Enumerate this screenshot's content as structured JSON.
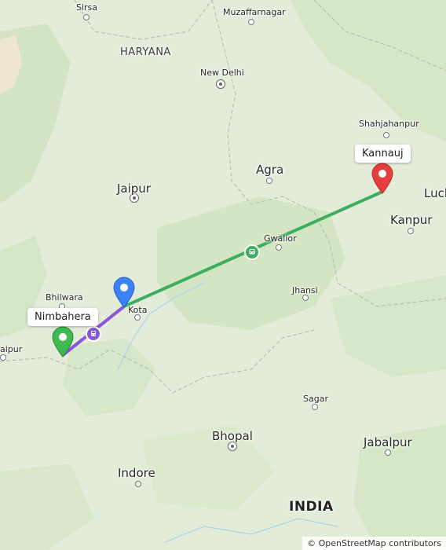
{
  "map": {
    "colors": {
      "land": "#e3ecd9",
      "forest": "#cfe2bf",
      "route_train": "#3dae5f",
      "route_bus": "#8a55d6",
      "pin_origin": "#3fb950",
      "pin_stop": "#3b82f6",
      "pin_destination": "#e53e3e"
    },
    "cities": [
      {
        "id": "sirsa",
        "name": "Sirsa"
      },
      {
        "id": "muzaffarnagar",
        "name": "Muzaffarnagar"
      },
      {
        "id": "haryana",
        "name": "HARYANA"
      },
      {
        "id": "new-delhi",
        "name": "New Delhi"
      },
      {
        "id": "shahjahanpur",
        "name": "Shahjahanpur"
      },
      {
        "id": "agra",
        "name": "Agra"
      },
      {
        "id": "jaipur",
        "name": "Jaipur"
      },
      {
        "id": "luck",
        "name": "Luck"
      },
      {
        "id": "kanpur",
        "name": "Kanpur"
      },
      {
        "id": "gwalior",
        "name": "Gwalior"
      },
      {
        "id": "bhilwara",
        "name": "Bhilwara"
      },
      {
        "id": "kota",
        "name": "Kota"
      },
      {
        "id": "jhansi",
        "name": "Jhansi"
      },
      {
        "id": "aipur",
        "name": "aipur"
      },
      {
        "id": "sagar",
        "name": "Sagar"
      },
      {
        "id": "bhopal",
        "name": "Bhopal"
      },
      {
        "id": "jabalpur",
        "name": "Jabalpur"
      },
      {
        "id": "indore",
        "name": "Indore"
      },
      {
        "id": "india",
        "name": "INDIA"
      }
    ],
    "markers": {
      "origin": {
        "label": "Nimbahera",
        "icon": "map-pin-icon"
      },
      "stop": {
        "icon": "map-pin-icon"
      },
      "destination": {
        "label": "Kannauj",
        "icon": "map-pin-icon"
      }
    },
    "route_icons": {
      "bus": "bus-icon",
      "train": "train-icon"
    },
    "attribution": "© OpenStreetMap contributors"
  }
}
